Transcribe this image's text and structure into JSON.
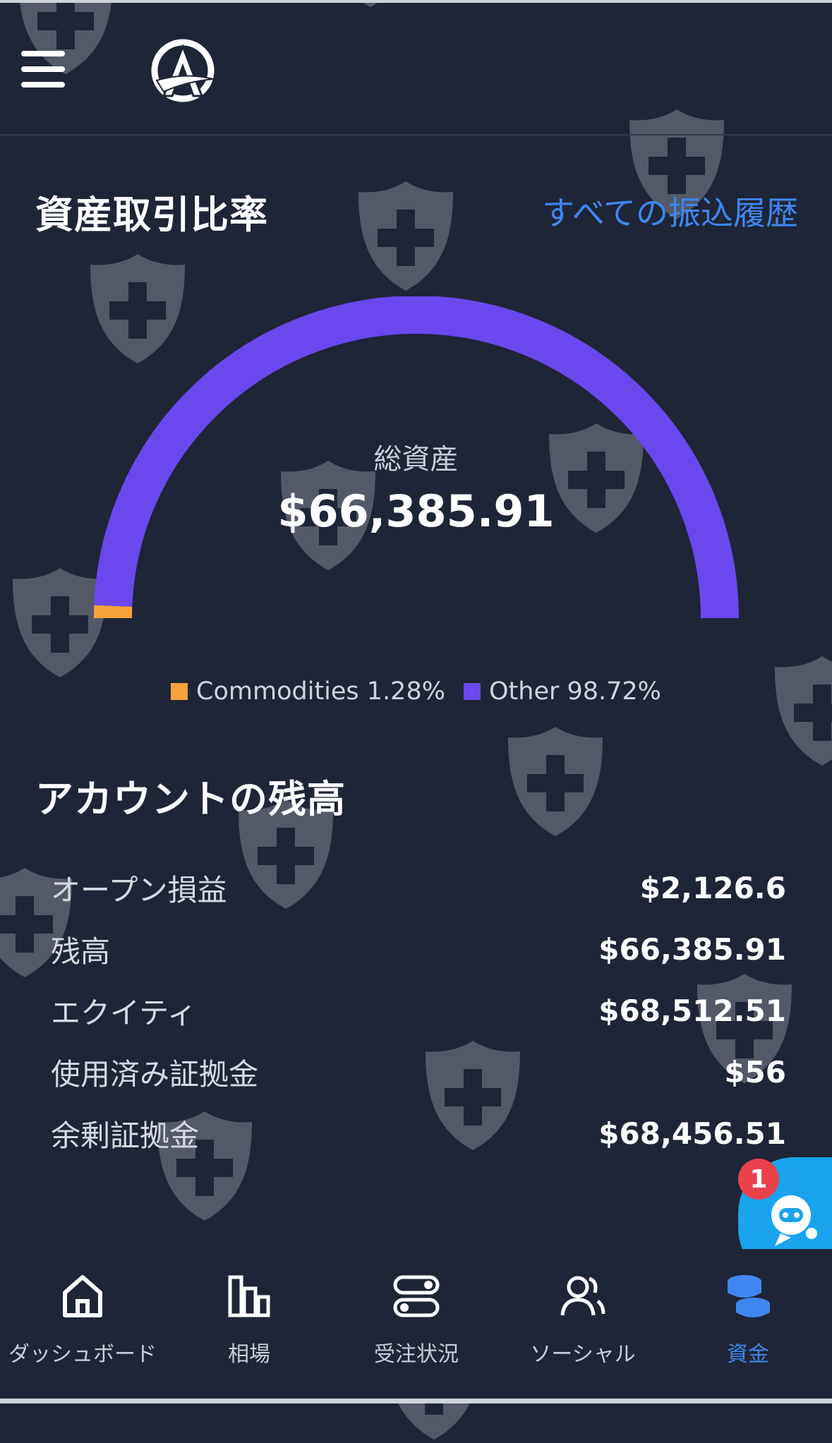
{
  "header": {
    "menu_icon": "hamburger-icon",
    "logo": "app-logo"
  },
  "allocation": {
    "title": "資産取引比率",
    "link": "すべての振込履歴",
    "total_label": "総資産",
    "total_value": "$66,385.91"
  },
  "chart_data": {
    "type": "pie",
    "style": "semicircle-gauge",
    "categories": [
      "Commodities",
      "Other"
    ],
    "values": [
      1.28,
      98.72
    ],
    "unit": "%",
    "colors": [
      "#f7a23a",
      "#6a48ee"
    ],
    "legend_labels": [
      "Commodities 1.28%",
      "Other 98.72%"
    ],
    "legend_position": "bottom"
  },
  "balances": {
    "title": "アカウントの残高",
    "rows": [
      {
        "label": "オープン損益",
        "value": "$2,126.6"
      },
      {
        "label": "残高",
        "value": "$66,385.91"
      },
      {
        "label": "エクイティ",
        "value": "$68,512.51"
      },
      {
        "label": "使用済み証拠金",
        "value": "$56"
      },
      {
        "label": "余剰証拠金",
        "value": "$68,456.51"
      }
    ]
  },
  "support": {
    "icon": "robot-icon",
    "badge": "1"
  },
  "nav": {
    "items": [
      {
        "label": "ダッシュボード",
        "icon": "home-icon"
      },
      {
        "label": "相場",
        "icon": "bar-chart-icon"
      },
      {
        "label": "受注状況",
        "icon": "toggles-icon"
      },
      {
        "label": "ソーシャル",
        "icon": "users-icon"
      },
      {
        "label": "資金",
        "icon": "coins-icon",
        "active": true
      }
    ]
  },
  "colors": {
    "background": "#1e2536",
    "accent": "#3f86f0",
    "gauge_main": "#6a48ee",
    "gauge_secondary": "#f7a23a",
    "badge": "#e9424b"
  }
}
